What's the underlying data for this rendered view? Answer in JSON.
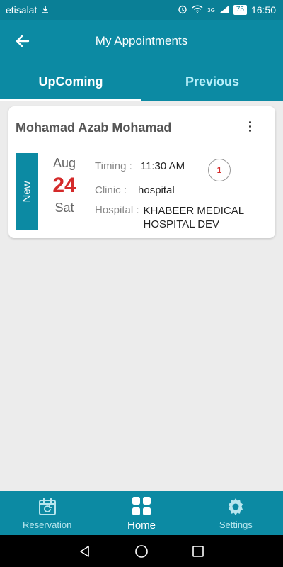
{
  "status_bar": {
    "carrier": "etisalat",
    "signal": "3G",
    "battery": "75",
    "time": "16:50"
  },
  "header": {
    "title": "My Appointments",
    "back_icon": "arrow-left-icon"
  },
  "tabs": [
    {
      "label": "UpComing",
      "active": true
    },
    {
      "label": "Previous",
      "active": false
    }
  ],
  "appointment": {
    "patient_name": "Mohamad Azab Mohamad",
    "status": "New",
    "month": "Aug",
    "day": "24",
    "weekday": "Sat",
    "timing_label": "Timing :",
    "timing_value": "11:30 AM",
    "queue_number": "1",
    "clinic_label": "Clinic :",
    "clinic_value": "hospital",
    "hospital_label": "Hospital :",
    "hospital_value": "KHABEER MEDICAL HOSPITAL DEV"
  },
  "bottom_nav": [
    {
      "label": "Reservation",
      "icon": "calendar-refresh-icon",
      "active": false
    },
    {
      "label": "Home",
      "icon": "grid-icon",
      "active": true
    },
    {
      "label": "Settings",
      "icon": "gear-icon",
      "active": false
    }
  ],
  "colors": {
    "primary": "#0c8aa3",
    "status_bar": "#0a7f96",
    "accent_red": "#d42a2a",
    "background": "#ececec"
  }
}
